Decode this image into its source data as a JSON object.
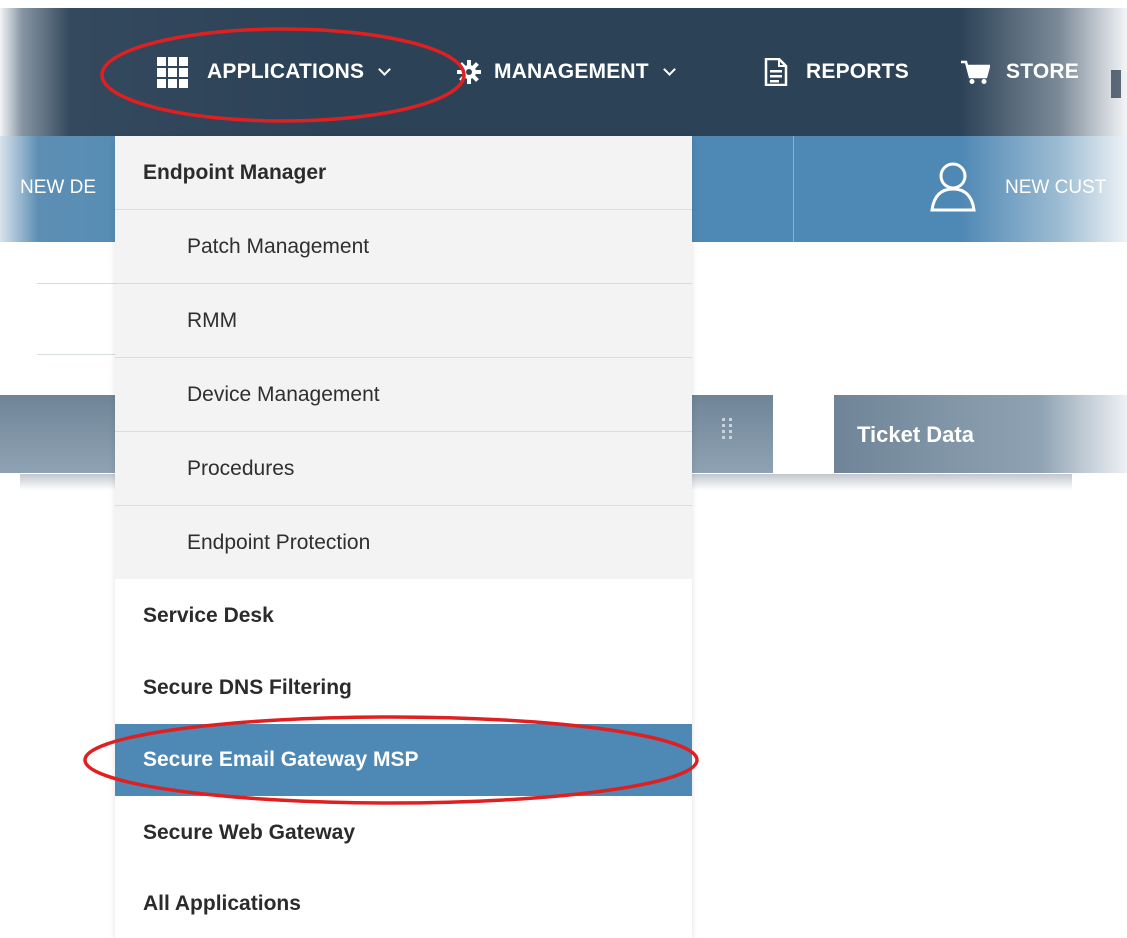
{
  "topnav": {
    "items": [
      {
        "label": "APPLICATIONS",
        "icon": "grid-icon"
      },
      {
        "label": "MANAGEMENT",
        "icon": "gear-icon"
      },
      {
        "label": "REPORTS",
        "icon": "document-icon"
      },
      {
        "label": "STORE",
        "icon": "cart-icon"
      }
    ]
  },
  "actionbar": {
    "left_label": "NEW DE",
    "right_label": "NEW CUST",
    "right_icon": "user-icon"
  },
  "widgets": {
    "right_title": "Ticket Data"
  },
  "dropdown": {
    "items": [
      {
        "label": "Endpoint Manager",
        "level": "heading"
      },
      {
        "label": "Patch Management",
        "level": "sub"
      },
      {
        "label": "RMM",
        "level": "sub"
      },
      {
        "label": "Device Management",
        "level": "sub"
      },
      {
        "label": "Procedures",
        "level": "sub"
      },
      {
        "label": "Endpoint Protection",
        "level": "sub"
      },
      {
        "label": "Service Desk",
        "level": "heading"
      },
      {
        "label": "Secure DNS Filtering",
        "level": "heading"
      },
      {
        "label": "Secure Email Gateway MSP",
        "level": "heading",
        "selected": true
      },
      {
        "label": "Secure Web Gateway",
        "level": "heading"
      },
      {
        "label": "All Applications",
        "level": "heading"
      }
    ]
  },
  "colors": {
    "nav_bg": "#2c4257",
    "action_bar_bg": "#4e88b4",
    "menu_highlight": "#4e88b4",
    "annotation": "#e02020"
  }
}
